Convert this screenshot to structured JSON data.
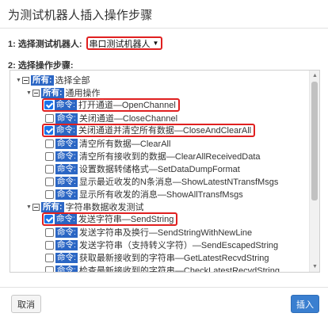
{
  "dialog": {
    "title": "为测试机器人插入操作步骤",
    "robot_label": "1: 选择测试机器人:",
    "robot_value": "串口测试机器人",
    "steps_label": "2: 选择操作步骤:",
    "cancel_label": "取消",
    "insert_label": "插入"
  },
  "tree": {
    "root": {
      "tag": "所有:",
      "label": "选择全部"
    },
    "groups": [
      {
        "tag": "所有:",
        "label": "通用操作",
        "items": [
          {
            "tag": "命令:",
            "label": "打开通道—OpenChannel",
            "checked": true,
            "highlighted": true
          },
          {
            "tag": "命令:",
            "label": "关闭通道—CloseChannel",
            "checked": false,
            "highlighted": false
          },
          {
            "tag": "命令:",
            "label": "关闭通道并清空所有数据—CloseAndClearAll",
            "checked": true,
            "highlighted": true
          },
          {
            "tag": "命令:",
            "label": "清空所有数据—ClearAll",
            "checked": false,
            "highlighted": false
          },
          {
            "tag": "命令:",
            "label": "清空所有接收到的数据—ClearAllReceivedData",
            "checked": false,
            "highlighted": false
          },
          {
            "tag": "命令:",
            "label": "设置数据转储格式—SetDataDumpFormat",
            "checked": false,
            "highlighted": false
          },
          {
            "tag": "命令:",
            "label": "显示最近收发的N条消息—ShowLatestNTransfMsgs",
            "checked": false,
            "highlighted": false
          },
          {
            "tag": "命令:",
            "label": "显示所有收发的消息—ShowAllTransfMsgs",
            "checked": false,
            "highlighted": false
          }
        ]
      },
      {
        "tag": "所有:",
        "label": "字符串数据收发测试",
        "items": [
          {
            "tag": "命令:",
            "label": "发送字符串—SendString",
            "checked": true,
            "highlighted": true
          },
          {
            "tag": "命令:",
            "label": "发送字符串及换行—SendStringWithNewLine",
            "checked": false,
            "highlighted": false
          },
          {
            "tag": "命令:",
            "label": "发送字符串（支持转义字符）—SendEscapedString",
            "checked": false,
            "highlighted": false
          },
          {
            "tag": "命令:",
            "label": "获取最新接收到的字符串—GetLatestRecvdString",
            "checked": false,
            "highlighted": false
          },
          {
            "tag": "命令:",
            "label": "检查最新接收到的字符串—CheckLatestRecvdString",
            "checked": false,
            "highlighted": false
          }
        ]
      }
    ]
  }
}
